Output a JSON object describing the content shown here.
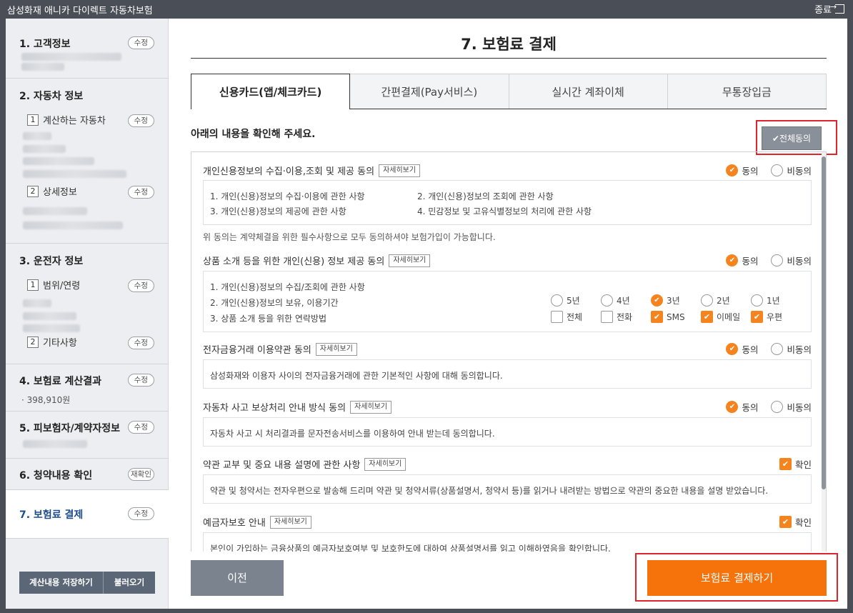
{
  "window": {
    "title": "삼성화재 애니카 다이렉트 자동차보험",
    "close_label": "종료"
  },
  "sidebar": {
    "sections": [
      {
        "title": "1. 고객정보",
        "button": "수정"
      },
      {
        "title": "2. 자동차 정보",
        "sub": [
          {
            "num": "1",
            "label": "계산하는 자동차",
            "button": "수정"
          },
          {
            "num": "2",
            "label": "상세정보",
            "button": "수정"
          }
        ]
      },
      {
        "title": "3. 운전자 정보",
        "sub": [
          {
            "num": "1",
            "label": "범위/연령",
            "button": "수정"
          },
          {
            "num": "2",
            "label": "기타사항",
            "button": "수정"
          }
        ]
      },
      {
        "title": "4. 보험료 계산결과",
        "button": "수정",
        "price": "· 398,910원"
      },
      {
        "title": "5. 피보험자/계약자정보",
        "button": "수정"
      },
      {
        "title": "6. 청약내용 확인",
        "button": "재확인"
      },
      {
        "title": "7. 보험료 결제",
        "button": "수정"
      }
    ],
    "save_button": "계산내용 저장하기",
    "load_button": "불러오기"
  },
  "main": {
    "title": "7. 보험료 결제",
    "tabs": [
      "신용카드(앱/체크카드)",
      "간편결제(Pay서비스)",
      "실시간 계좌이체",
      "무통장입금"
    ],
    "instruction": "아래의 내용을 확인해 주세요.",
    "agree_all": "전체동의",
    "detail_label": "자세히보기",
    "agree_label": "동의",
    "disagree_label": "비동의",
    "confirm_label": "확인",
    "sections": {
      "s1": {
        "title": "개인신용정보의 수집·이용,조회 및 제공 동의",
        "items": [
          "1. 개인(신용)정보의 수집·이용에 관한 사항",
          "2. 개인(신용)정보의 조회에 관한 사항",
          "3. 개인(신용)정보의 제공에 관한 사항",
          "4. 민감정보 및 고유식별정보의 처리에 관한 사항"
        ],
        "note": "위 동의는 계약체결을 위한 필수사항으로 모두 동의하셔야 보험가입이 가능합니다."
      },
      "s2": {
        "title": "상품 소개 등을 위한 개인(신용) 정보 제공 동의",
        "items": [
          "1. 개인(신용)정보의 수집/조회에 관한 사항",
          "2. 개인(신용)정보의 보유, 이용기간",
          "3. 상품 소개 등을 위한 연락방법"
        ],
        "periods": [
          "5년",
          "4년",
          "3년",
          "2년",
          "1년"
        ],
        "selected_period": "3년",
        "contact_methods": [
          "전체",
          "전화",
          "SMS",
          "이메일",
          "우편"
        ],
        "contact_checked": [
          "SMS",
          "이메일",
          "우편"
        ]
      },
      "s3": {
        "title": "전자금융거래 이용약관 동의",
        "text": "삼성화재와 이용자 사이의 전자금융거래에 관한 기본적인 사항에 대해 동의합니다."
      },
      "s4": {
        "title": "자동차 사고 보상처리 안내 방식 동의",
        "text": "자동차 사고 시 처리결과를 문자전송서비스를 이용하여 안내 받는데 동의합니다."
      },
      "s5": {
        "title": "약관 교부 및 중요 내용 설명에 관한 사항",
        "text": "약관 및 청약서는 전자우편으로 발송해 드리며 약관 및 청약서류(상품설명서, 청약서 등)를 읽거나 내려받는 방법으로 약관의 중요한 내용을 설명 받았습니다."
      },
      "s6": {
        "title": "예금자보호 안내",
        "text": "본인이 가입하는 금융상품의 예금자보호여부 및 보호한도에 대하여 상품설명서를 읽고 이해하였음을 확인합니다."
      }
    },
    "prev_button": "이전",
    "pay_button": "보험료 결제하기"
  },
  "colors": {
    "accent": "#f5841f",
    "pay": "#f5730a",
    "highlight": "#e0242b",
    "sidebar_active": "#1e4d8a"
  }
}
